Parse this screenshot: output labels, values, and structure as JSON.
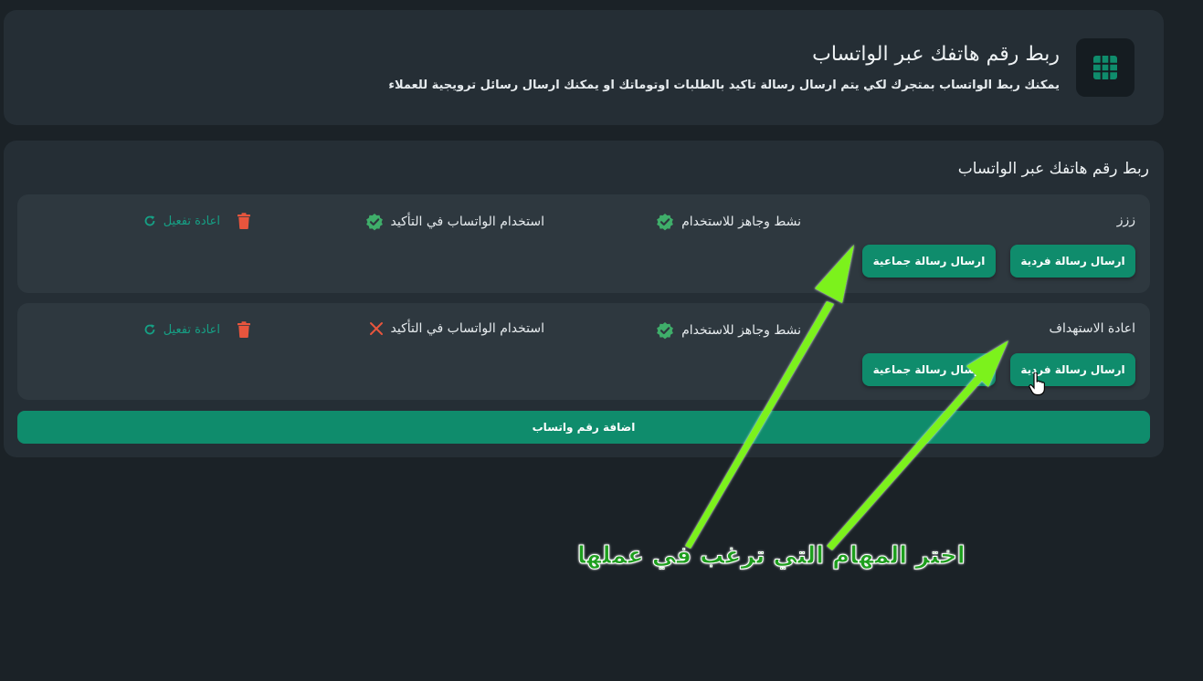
{
  "header": {
    "title": "ربط رقم هاتفك عبر الواتساب",
    "subtitle": "يمكنك ربط الواتساب بمتجرك لكي يتم ارسال رسالة تاكيد بالطلبات اوتوماتك او يمكنك ارسال رسائل ترويجية للعملاء",
    "logo_icon": "grid-icon"
  },
  "section": {
    "title": "ربط رقم هاتفك عبر الواتساب"
  },
  "numbers": [
    {
      "name": "ززز",
      "active_status": "نشط وجاهز للاستخدام",
      "active_icon": "verified-check-icon",
      "confirm_status": "استخدام الواتساب في التأكيد",
      "confirm_icon": "verified-check-icon",
      "reactivate_label": "اعادة تفعيل",
      "single_message_label": "ارسال رسالة فردية",
      "group_message_label": "ارسال رسالة جماعية"
    },
    {
      "name": "اعادة الاستهداف",
      "active_status": "نشط وجاهز للاستخدام",
      "active_icon": "verified-check-icon",
      "confirm_status": "استخدام الواتساب في التأكيد",
      "confirm_icon": "x-icon",
      "reactivate_label": "اعادة تفعيل",
      "single_message_label": "ارسال رسالة فردية",
      "group_message_label": "ارسال رسالة جماعية"
    }
  ],
  "add_number_label": "اضافة رقم واتساب",
  "annotation": {
    "text": "اختر المهام التي ترغب في عملها"
  },
  "colors": {
    "background": "#1b2227",
    "panel": "#252e35",
    "card": "#2e383f",
    "accent": "#0f8c6c",
    "success": "#3fae6a",
    "danger": "#e8553d",
    "annotation_arrow": "#7cf21a"
  }
}
